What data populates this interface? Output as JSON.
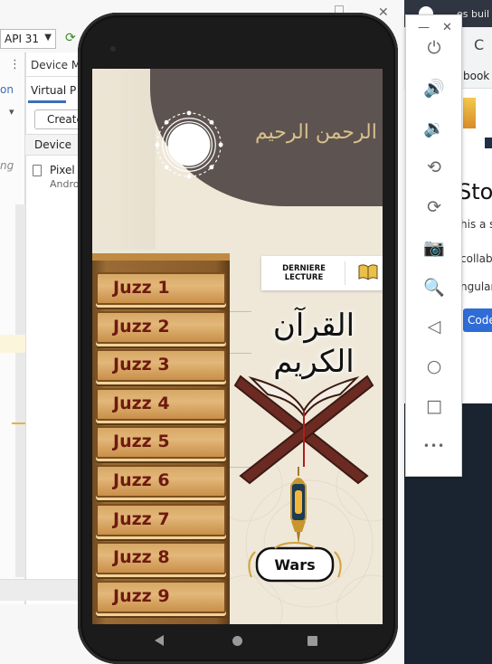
{
  "ide": {
    "api_label": "API 31",
    "tab_on": "on",
    "ng_label": "ng",
    "device_manager_title": "Device M",
    "virtual_tab": "Virtual",
    "physical_tab_partial": "P",
    "create_button": "Create",
    "device_column": "Device",
    "device_name": "Pixel 5",
    "device_sub": "Andro"
  },
  "browser": {
    "tab_title": "es buil",
    "bookmark": "book",
    "heading_partial": "Stoc",
    "line1": "his a s",
    "line2": "collab",
    "line3": "ngular",
    "code_button": "Code"
  },
  "emulator_controls": [
    {
      "name": "power-icon",
      "glyph": "⏻"
    },
    {
      "name": "volume-up-icon",
      "glyph": "🔊"
    },
    {
      "name": "volume-down-icon",
      "glyph": "🔉"
    },
    {
      "name": "rotate-left-icon",
      "glyph": "⟲"
    },
    {
      "name": "rotate-right-icon",
      "glyph": "⟳"
    },
    {
      "name": "camera-icon",
      "glyph": "📷"
    },
    {
      "name": "zoom-icon",
      "glyph": "🔍"
    },
    {
      "name": "back-icon",
      "glyph": "◁"
    },
    {
      "name": "home-icon",
      "glyph": "○"
    },
    {
      "name": "overview-icon",
      "glyph": "□"
    },
    {
      "name": "more-icon",
      "glyph": "•••"
    }
  ],
  "app": {
    "basmala": "بسم الله الرحمن الرحيم",
    "quran_title": "القرآن الكريم",
    "last_reading": "DERNIERE LECTURE",
    "wars_label": "Wars",
    "juzz": [
      "Juzz 1",
      "Juzz 2",
      "Juzz 3",
      "Juzz 4",
      "Juzz 5",
      "Juzz 6",
      "Juzz 7",
      "Juzz 8",
      "Juzz 9"
    ]
  },
  "colors": {
    "header_brown": "#5d5350",
    "juzz_text": "#6e1a0e",
    "screen_bg": "#efe8d9"
  }
}
